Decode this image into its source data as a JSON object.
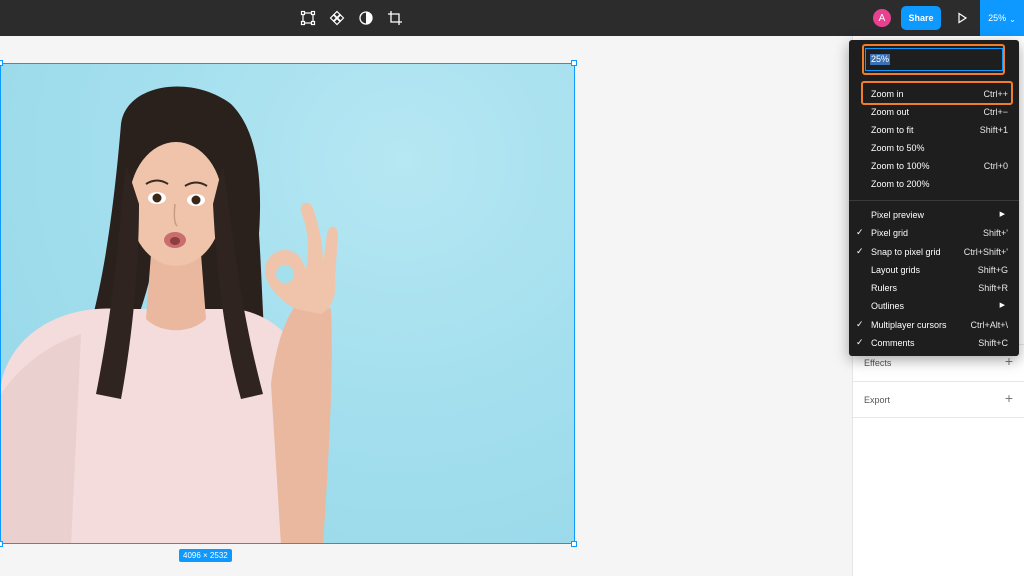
{
  "toolbar": {
    "avatar_initial": "A",
    "share_label": "Share",
    "zoom_value": "25%",
    "tools": [
      "frame-select-icon",
      "component-icon",
      "contrast-icon",
      "crop-icon"
    ]
  },
  "canvas": {
    "image_size": "4096 × 2532"
  },
  "right_panel": {
    "sections": [
      {
        "label": "Effects"
      },
      {
        "label": "Export"
      }
    ]
  },
  "zoom_menu": {
    "input_value": "25%",
    "items": [
      {
        "label": "Zoom in",
        "shortcut": "Ctrl++",
        "checked": false,
        "submenu": false
      },
      {
        "label": "Zoom out",
        "shortcut": "Ctrl+−",
        "checked": false,
        "submenu": false
      },
      {
        "label": "Zoom to fit",
        "shortcut": "Shift+1",
        "checked": false,
        "submenu": false
      },
      {
        "label": "Zoom to 50%",
        "shortcut": "",
        "checked": false,
        "submenu": false
      },
      {
        "label": "Zoom to 100%",
        "shortcut": "Ctrl+0",
        "checked": false,
        "submenu": false
      },
      {
        "label": "Zoom to 200%",
        "shortcut": "",
        "checked": false,
        "submenu": false
      },
      {
        "label": "Pixel preview",
        "shortcut": "",
        "checked": false,
        "submenu": true
      },
      {
        "label": "Pixel grid",
        "shortcut": "Shift+'",
        "checked": true,
        "submenu": false
      },
      {
        "label": "Snap to pixel grid",
        "shortcut": "Ctrl+Shift+'",
        "checked": true,
        "submenu": false
      },
      {
        "label": "Layout grids",
        "shortcut": "Shift+G",
        "checked": false,
        "submenu": false
      },
      {
        "label": "Rulers",
        "shortcut": "Shift+R",
        "checked": false,
        "submenu": false
      },
      {
        "label": "Outlines",
        "shortcut": "",
        "checked": false,
        "submenu": true
      },
      {
        "label": "Multiplayer cursors",
        "shortcut": "Ctrl+Alt+\\",
        "checked": true,
        "submenu": false
      },
      {
        "label": "Comments",
        "shortcut": "Shift+C",
        "checked": true,
        "submenu": false
      }
    ]
  },
  "colors": {
    "accent": "#0d99ff",
    "highlight": "#f07d2c",
    "toolbar_bg": "#2c2c2c",
    "menu_bg": "#1e1e1e",
    "avatar": "#e8418f"
  }
}
